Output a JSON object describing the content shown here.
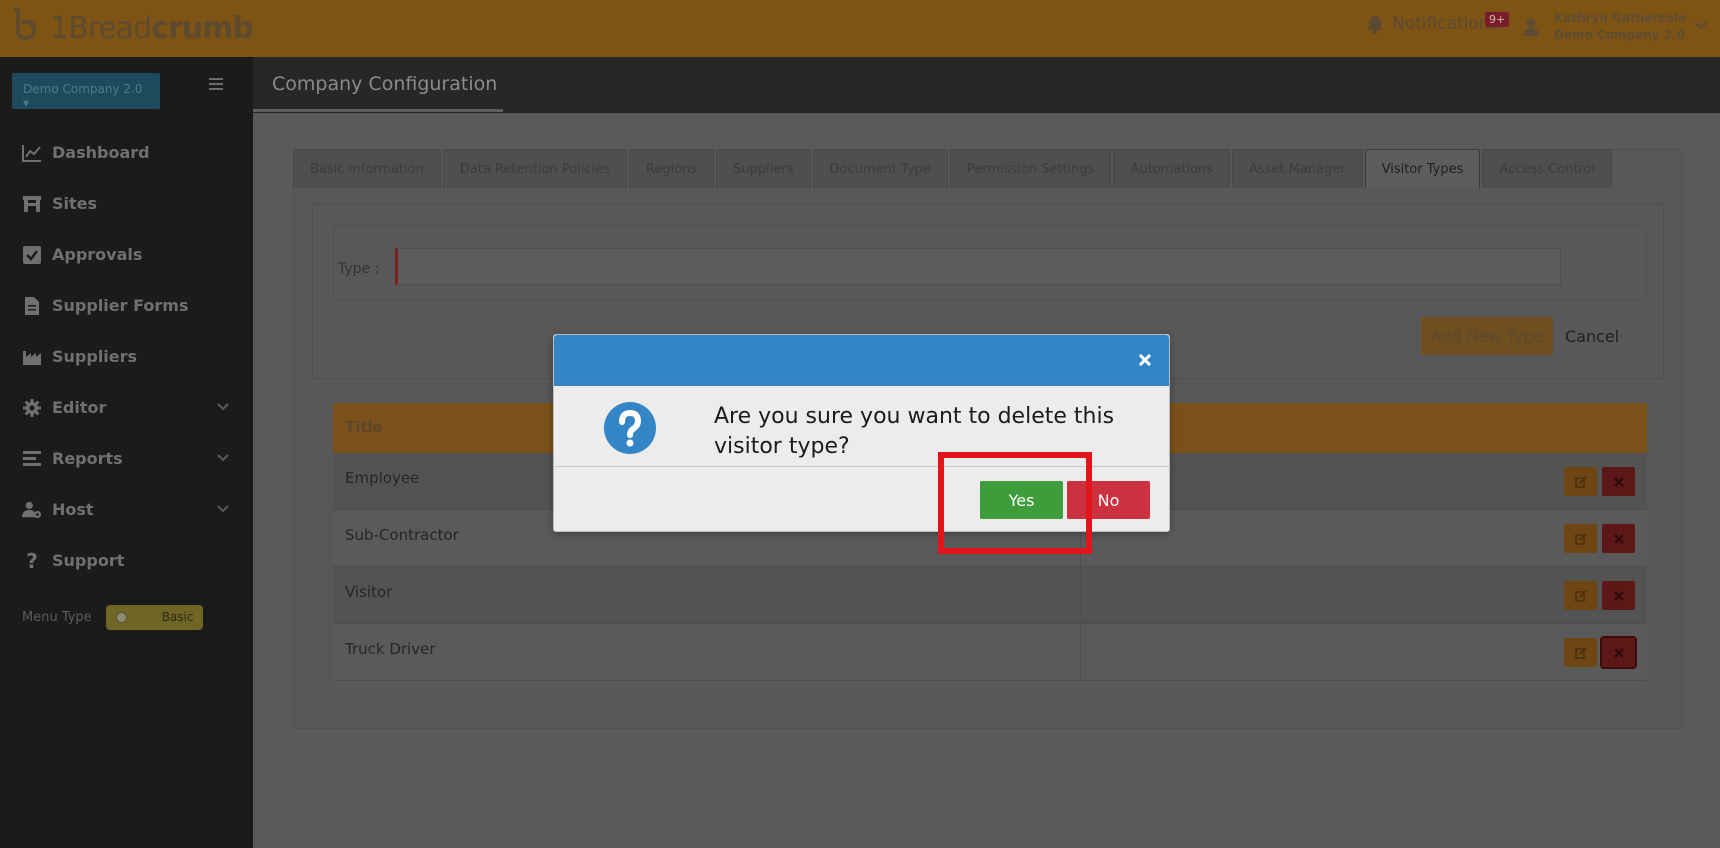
{
  "colors": {
    "brand_orange": "#7e5414",
    "modal_header": "#3385c6",
    "yes_green": "#3d9d3a",
    "no_red": "#cc3140",
    "highlight_red": "#e2141c"
  },
  "topbar": {
    "logo_text_thin": "1Bread",
    "logo_text_bold": "crumb",
    "notifications_label": "Notifications",
    "notifications_badge": "9+",
    "user_name": "Kathryn Gathercole",
    "user_company": "Demo Company 2.0"
  },
  "sidebar": {
    "company_button": "Demo Company 2.0 ▾",
    "items": [
      {
        "label": "Dashboard",
        "icon": "chart-icon"
      },
      {
        "label": "Sites",
        "icon": "building-icon"
      },
      {
        "label": "Approvals",
        "icon": "checkbox-icon"
      },
      {
        "label": "Supplier Forms",
        "icon": "file-icon"
      },
      {
        "label": "Suppliers",
        "icon": "industry-icon"
      },
      {
        "label": "Editor",
        "icon": "gear-icon"
      },
      {
        "label": "Reports",
        "icon": "list-icon"
      },
      {
        "label": "Host",
        "icon": "user-gear-icon"
      },
      {
        "label": "Support",
        "icon": "question-icon"
      }
    ],
    "menu_type_label": "Menu Type",
    "menu_type_toggle": "Basic"
  },
  "header": {
    "title": "Company Configuration"
  },
  "tabs": [
    "Basic Information",
    "Data Retention Policies",
    "Regions",
    "Suppliers",
    "Document Type",
    "Permission Settings",
    "Automations",
    "Asset Manager",
    "Visitor Types",
    "Access Control"
  ],
  "active_tab": "Visitor Types",
  "form": {
    "type_label": "Type :",
    "type_value": "",
    "add_button": "Add New Type",
    "cancel_link": "Cancel"
  },
  "table": {
    "header": "Title",
    "rows": [
      "Employee",
      "Sub-Contractor",
      "Visitor",
      "Truck Driver"
    ]
  },
  "modal": {
    "message": "Are you sure you want to delete this visitor type?",
    "yes_label": "Yes",
    "no_label": "No"
  }
}
